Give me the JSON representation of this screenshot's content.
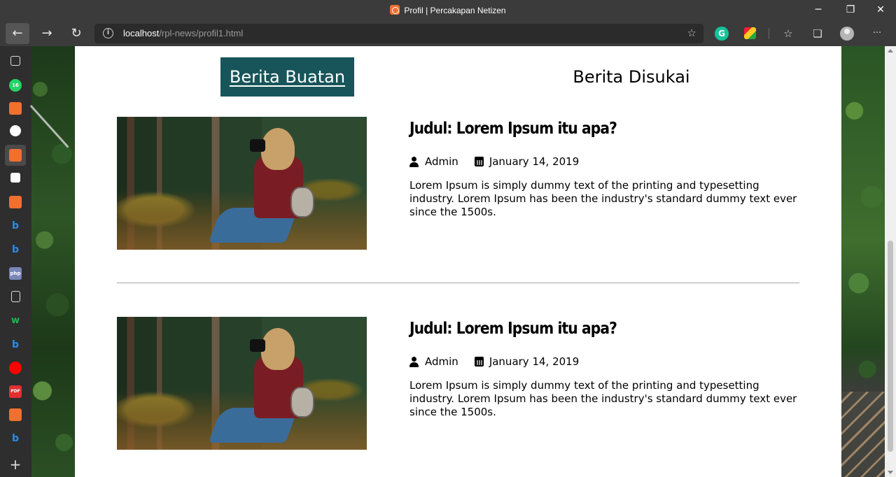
{
  "window": {
    "title": "Profil | Percakapan Netizen",
    "controls": {
      "minimize": "─",
      "restore": "❐",
      "close": "✕"
    }
  },
  "browser": {
    "back_icon": "←",
    "forward_icon": "→",
    "refresh_icon": "↻",
    "url_host": "localhost",
    "url_path": "/rpl-news/profil1.html",
    "grammarly_label": "G",
    "more_label": "···"
  },
  "sidebar": {
    "items": [
      {
        "name": "tab-actions-icon"
      },
      {
        "name": "whatsapp-icon",
        "badge": "16",
        "color": "#25d366"
      },
      {
        "name": "app-orange-icon",
        "color": "#f07030"
      },
      {
        "name": "github-icon"
      },
      {
        "name": "xampp-icon",
        "color": "#f07030"
      },
      {
        "name": "notion-icon"
      },
      {
        "name": "app-orange-2-icon",
        "color": "#f07030"
      },
      {
        "name": "bing-icon",
        "color": "#2b8ce8"
      },
      {
        "name": "bing-2-icon",
        "color": "#2b8ce8"
      },
      {
        "name": "php-icon",
        "label": "php",
        "color": "#7a86b8"
      },
      {
        "name": "document-icon"
      },
      {
        "name": "w-app-icon",
        "label": "w",
        "color": "#1db954"
      },
      {
        "name": "bing-3-icon",
        "color": "#2b8ce8"
      },
      {
        "name": "youtube-icon",
        "color": "#ff0000"
      },
      {
        "name": "pdf-icon",
        "label": "PDF",
        "color": "#e03030"
      },
      {
        "name": "xampp-2-icon",
        "color": "#f07030"
      },
      {
        "name": "bing-4-icon",
        "color": "#2b8ce8"
      }
    ],
    "add_label": "+"
  },
  "page": {
    "tabs": {
      "created": "Berita Buatan",
      "liked": "Berita Disukai"
    },
    "articles": [
      {
        "title": "Judul: Lorem Ipsum itu apa?",
        "author": "Admin",
        "date": "January 14, 2019",
        "excerpt": "Lorem Ipsum is simply dummy text of the printing and typesetting industry. Lorem Ipsum has been the industry's standard dummy text ever since the 1500s."
      },
      {
        "title": "Judul: Lorem Ipsum itu apa?",
        "author": "Admin",
        "date": "January 14, 2019",
        "excerpt": "Lorem Ipsum is simply dummy text of the printing and typesetting industry. Lorem Ipsum has been the industry's standard dummy text ever since the 1500s."
      }
    ]
  },
  "colors": {
    "active_tab_bg": "#17555a",
    "chrome_bg": "#3b3b3b",
    "sidebar_bg": "#2e2e2e"
  }
}
